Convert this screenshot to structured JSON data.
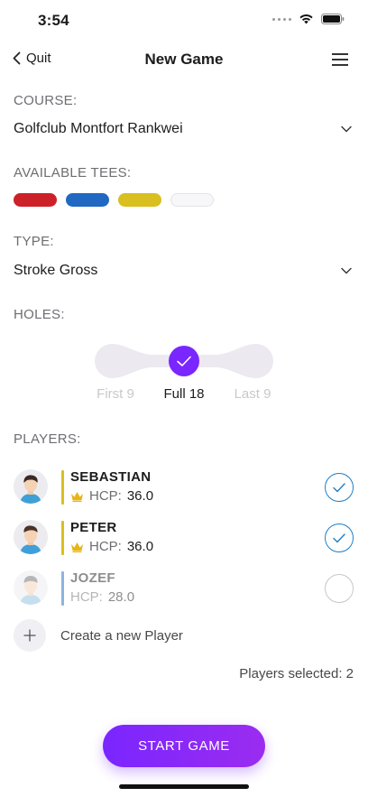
{
  "status_bar": {
    "time": "3:54"
  },
  "nav": {
    "back_label": "Quit",
    "title": "New Game"
  },
  "course": {
    "label": "COURSE:",
    "value": "Golfclub Montfort Rankwei"
  },
  "tees": {
    "label": "AVAILABLE TEES:",
    "items": [
      {
        "name": "red",
        "color": "#cc2128"
      },
      {
        "name": "blue",
        "color": "#2068c2"
      },
      {
        "name": "yellow",
        "color": "#d9bf1f"
      },
      {
        "name": "white",
        "color": "#f7f7f9"
      }
    ]
  },
  "type": {
    "label": "TYPE:",
    "value": "Stroke Gross"
  },
  "holes": {
    "label": "HOLES:",
    "options": [
      "First 9",
      "Full 18",
      "Last 9"
    ],
    "selected": "Full 18"
  },
  "players": {
    "label": "PLAYERS:",
    "items": [
      {
        "name": "SEBASTIAN",
        "hcp_label": "HCP:",
        "hcp": "36.0",
        "tee_color": "#d9bf1f",
        "crown": true,
        "selected": true
      },
      {
        "name": "PETER",
        "hcp_label": "HCP:",
        "hcp": "36.0",
        "tee_color": "#d9bf1f",
        "crown": true,
        "selected": true
      },
      {
        "name": "JOZEF",
        "hcp_label": "HCP:",
        "hcp": "28.0",
        "tee_color": "#2068c2",
        "crown": false,
        "selected": false
      }
    ],
    "create_label": "Create a new Player",
    "selected_text": "Players selected: 2"
  },
  "start_label": "START GAME",
  "colors": {
    "accent": "#7a26ff",
    "check": "#1e7fc7"
  }
}
